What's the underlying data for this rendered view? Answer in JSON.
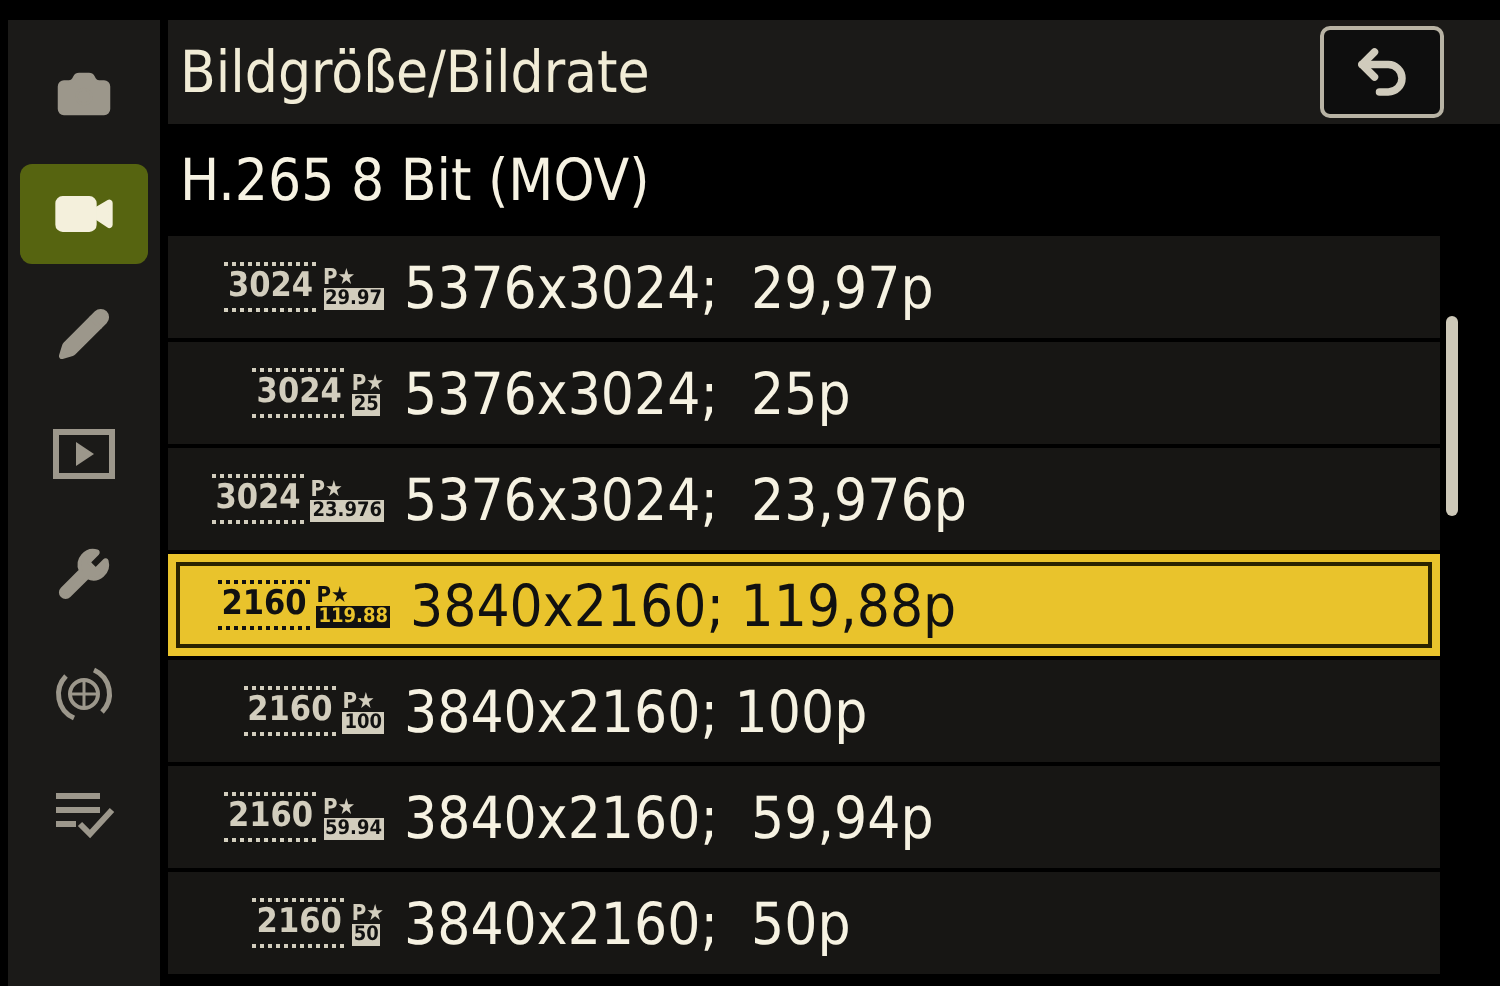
{
  "sidebar": {
    "tabs": [
      {
        "kind": "photo",
        "selected": false
      },
      {
        "kind": "video",
        "selected": true
      },
      {
        "kind": "edit",
        "selected": false
      },
      {
        "kind": "playback",
        "selected": false
      },
      {
        "kind": "setup",
        "selected": false
      },
      {
        "kind": "network",
        "selected": false
      },
      {
        "kind": "mymenu",
        "selected": false
      }
    ]
  },
  "title": "Bildgröße/Bildrate",
  "subtitle": "H.265 8 Bit (MOV)",
  "rows": [
    {
      "size": "3024",
      "quality": "P★",
      "rate": "29.97",
      "label": "5376x3024;  29,97p",
      "selected": false
    },
    {
      "size": "3024",
      "quality": "P★",
      "rate": "25",
      "label": "5376x3024;  25p",
      "selected": false
    },
    {
      "size": "3024",
      "quality": "P★",
      "rate": "23.976",
      "label": "5376x3024;  23,976p",
      "selected": false
    },
    {
      "size": "2160",
      "quality": "P★",
      "rate": "119.88",
      "label": "3840x2160; 119,88p",
      "selected": true
    },
    {
      "size": "2160",
      "quality": "P★",
      "rate": "100",
      "label": "3840x2160; 100p",
      "selected": false
    },
    {
      "size": "2160",
      "quality": "P★",
      "rate": "59.94",
      "label": "3840x2160;  59,94p",
      "selected": false
    },
    {
      "size": "2160",
      "quality": "P★",
      "rate": "50",
      "label": "3840x2160;  50p",
      "selected": false
    }
  ]
}
